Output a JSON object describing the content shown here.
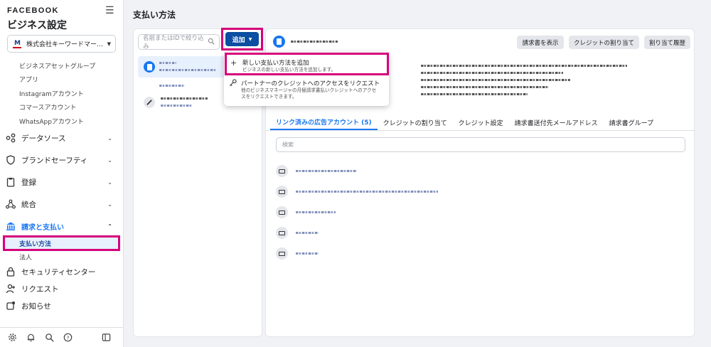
{
  "sidebar": {
    "brand": "FACEBOOK",
    "title": "ビジネス設定",
    "business_name": "株式会社キーワードマー…",
    "business_logo_text": "M",
    "sub_items": [
      "ビジネスアセットグループ",
      "アプリ",
      "Instagramアカウント",
      "コマースアカウント",
      "WhatsAppアカウント"
    ],
    "nav": {
      "data_sources": "データソース",
      "brand_safety": "ブランドセーフティ",
      "registration": "登録",
      "integrations": "統合",
      "billing": "請求と支払い",
      "payment_methods": "支払い方法",
      "corporation": "法人",
      "security_center": "セキュリティセンター",
      "requests": "リクエスト",
      "notifications": "お知らせ"
    }
  },
  "main": {
    "page_title": "支払い方法",
    "search_placeholder": "名前またはIDで絞り込み",
    "add_button": "追加",
    "dropdown": {
      "item1_title": "新しい支払い方法を追加",
      "item1_desc": "ビジネスの新しい支払い方法を追加します。",
      "item2_title": "パートナーのクレジットへのアクセスをリクエスト",
      "item2_desc_line1": "他のビジネスマネージャの月極請求書払いクレジットへのアクセ",
      "item2_desc_line2": "スをリクエストできます。"
    },
    "header_buttons": {
      "view_invoice": "請求書を表示",
      "assign_credit": "クレジットの割り当て",
      "assign_history": "割り当て履歴"
    },
    "tabs": [
      "リンク済みの広告アカウント (5)",
      "クレジットの割り当て",
      "クレジット設定",
      "請求書送付先メールアドレス",
      "請求書グループ"
    ],
    "account_search_placeholder": "検索"
  },
  "colors": {
    "accent": "#1877f2",
    "highlight": "#d6007a",
    "add_button": "#0b4ea2"
  }
}
